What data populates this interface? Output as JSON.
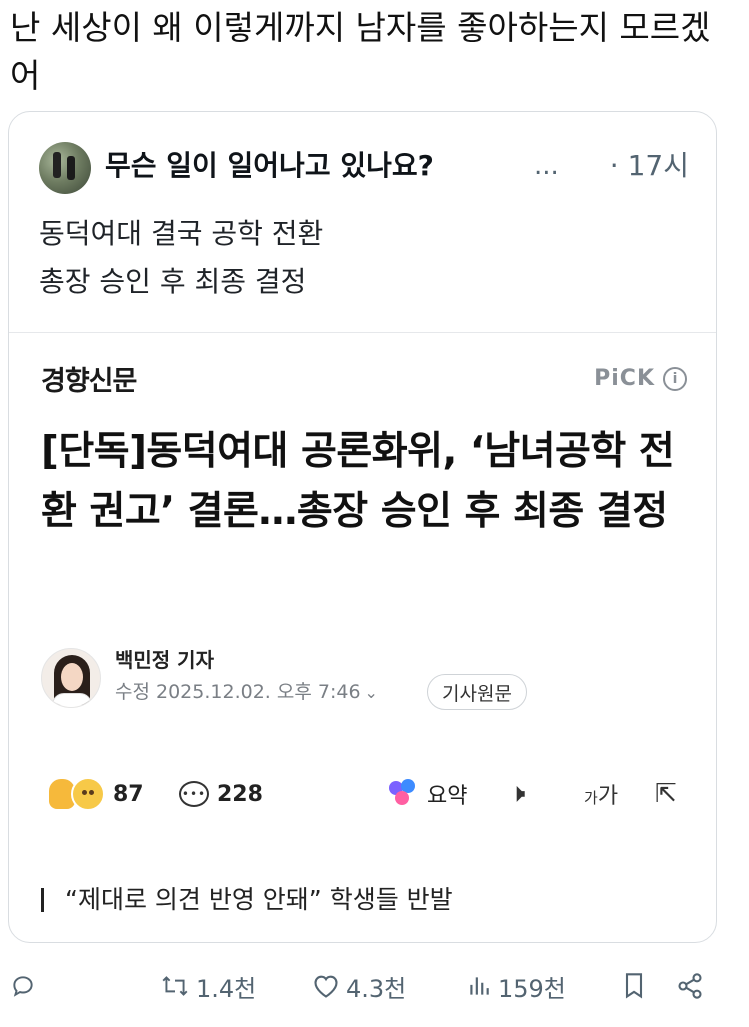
{
  "post": {
    "text": "난 세상이 왜 이렇게까지 남자를 좋아하는지 모르겠어"
  },
  "quoted": {
    "author": "무슨 일이 일어나고 있나요?",
    "ellipsis": "...",
    "time": "· 17시",
    "line1": "동덕여대 결국 공학 전환",
    "line2": "총장 승인 후 최종 결정"
  },
  "news": {
    "publisher": "경향신문",
    "pick_label": "PiCK",
    "info_glyph": "i",
    "headline": "[단독]동덕여대 공론화위, ‘남녀공학 전환 권고’ 결론…총장 승인 후 최종 결정",
    "reporter_name": "백민정 기자",
    "updated": "수정 2025.12.02. 오후 7:46",
    "original_button": "기사원문",
    "reactions_count": "87",
    "comments_count": "228",
    "summary_label": "요약",
    "quote_line": "“제대로 의견 반영 안돼” 학생들 반발"
  },
  "icons": {
    "reaction": "clap-emoji-icon",
    "comment": "comment-icon",
    "summary": "ai-summary-icon",
    "listen": "speaker-icon",
    "font_size": "font-size-icon",
    "share": "share-icon"
  },
  "bottom_bar": {
    "retweets": "1.4천",
    "likes": "4.3천",
    "views": "159천"
  },
  "colors": {
    "text_secondary": "#536471",
    "border": "#d9dde1"
  }
}
